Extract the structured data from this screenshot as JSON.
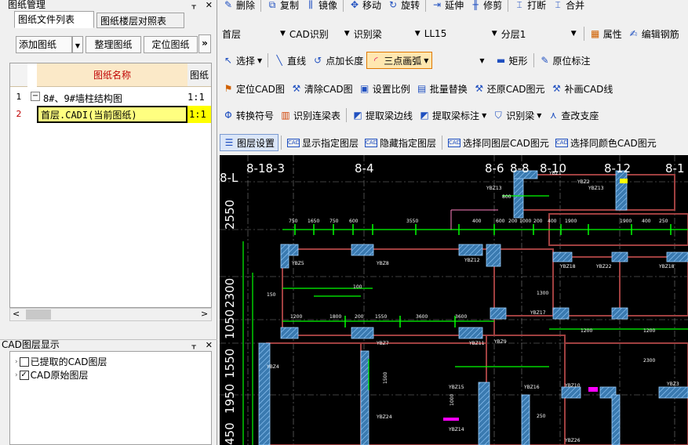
{
  "left": {
    "top_panel_title": "图纸管理",
    "tabs": [
      "图纸文件列表",
      "图纸楼层对照表"
    ],
    "buttons": [
      "添加图纸",
      "整理图纸",
      "定位图纸"
    ],
    "grid": {
      "headers": [
        "图纸名称",
        "图纸"
      ],
      "rows": [
        {
          "num": "1",
          "expand": "−",
          "name": "8#、9#墙柱结构图",
          "ratio": "1:1"
        },
        {
          "num": "2",
          "name": "首层.CADI(当前图纸)",
          "ratio": "1:1"
        }
      ]
    },
    "bottom_panel_title": "CAD图层显示",
    "layers": [
      {
        "label": "已提取的CAD图层",
        "checked": false
      },
      {
        "label": "CAD原始图层",
        "checked": true
      }
    ]
  },
  "toolbar1": [
    "删除",
    "复制",
    "镜像",
    "移动",
    "旋转",
    "延伸",
    "修剪",
    "打断",
    "合并"
  ],
  "toolbar2": {
    "floor": "首层",
    "cad_identify": "CAD识别",
    "identify_beam": "识别梁",
    "beam_type": "LL15",
    "layer": "分层1",
    "attr": "属性",
    "edit": "编辑钢筋"
  },
  "toolbar3": [
    "选择",
    "直线",
    "点加长度",
    "三点画弧",
    "矩形",
    "原位标注"
  ],
  "toolbar4": [
    "定位CAD图",
    "清除CAD图",
    "设置比例",
    "批量替换",
    "还原CAD图元",
    "补画CAD线"
  ],
  "toolbar5": [
    "转换符号",
    "识别连梁表",
    "提取梁边线",
    "提取梁标注",
    "识别梁",
    "查改支座"
  ],
  "toolbar6": [
    "图层设置",
    "显示指定图层",
    "隐藏指定图层",
    "选择同图层CAD图元",
    "选择同颜色CAD图元"
  ],
  "drawing": {
    "axes_top": [
      "8-18-3",
      "8-4",
      "8-6",
      "8-8",
      "8-10",
      "8-12",
      "8-1"
    ],
    "axes_left": [
      "8-L",
      "2550",
      "2300",
      "1050",
      "1550",
      "1950",
      "450"
    ],
    "dims": [
      "750",
      "1650",
      "750",
      "600",
      "3550",
      "400",
      "600",
      "200",
      "1000",
      "200",
      "400",
      "1900",
      "1900",
      "400",
      "250",
      "1200",
      "1800",
      "200",
      "1550",
      "3600",
      "3600",
      "1200",
      "1200",
      "2300",
      "1000",
      "1500",
      "1300",
      "800",
      "100",
      "150",
      "250"
    ],
    "tags": [
      "YBZ13",
      "YBZ13",
      "YBZ5",
      "YBZ8",
      "YBZ12",
      "YBZ18",
      "YBZ22",
      "YBZ18",
      "YBZ17",
      "YBZ7",
      "YBZ11",
      "YBZ4",
      "YBZ15",
      "YBZ16",
      "YBZ10",
      "YBZ3",
      "YBZ26",
      "YBZ14",
      "YBZ24",
      "YBZ2",
      "YBZ9",
      "YBZ1"
    ]
  }
}
